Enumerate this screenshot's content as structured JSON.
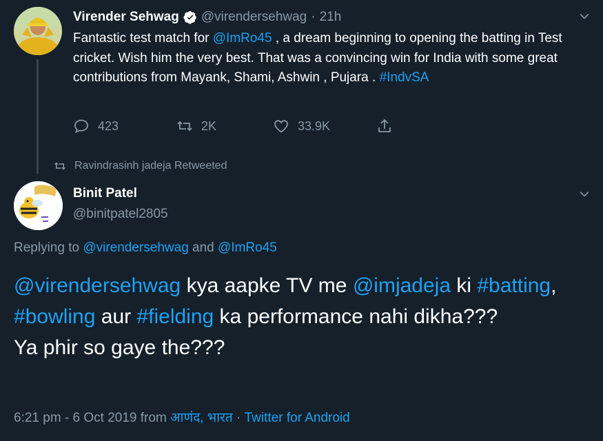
{
  "tweet1": {
    "name": "Virender Sehwag",
    "handle": "@virendersehwag",
    "separator": "·",
    "time": "21h",
    "text_parts": [
      {
        "t": "Fantastic test match for ",
        "link": false
      },
      {
        "t": "@ImRo45",
        "link": true
      },
      {
        "t": " , a dream beginning to opening the batting in Test cricket. Wish him the very best. That was a convincing win for India with some great contributions from Mayank, Shami, Ashwin , Pujara . ",
        "link": false
      },
      {
        "t": "#IndvSA",
        "link": true
      }
    ],
    "actions": {
      "replies": "423",
      "retweets": "2K",
      "likes": "33.9K"
    },
    "icons": [
      "verified-badge-icon",
      "chevron-down-icon",
      "reply-icon",
      "retweet-icon",
      "like-icon",
      "share-icon"
    ]
  },
  "retweet_context": {
    "label": "Ravindrasinh jadeja Retweeted"
  },
  "tweet2": {
    "name": "Binit Patel",
    "handle": "@binitpatel2805",
    "replying_prefix": "Replying to ",
    "replying_user1": "@virendersehwag",
    "replying_and": " and ",
    "replying_user2": "@ImRo45",
    "text_parts": [
      {
        "t": "@virendersehwag",
        "link": true
      },
      {
        "t": " kya aapke TV me ",
        "link": false
      },
      {
        "t": "@imjadeja",
        "link": true
      },
      {
        "t": " ki ",
        "link": false
      },
      {
        "t": "#batting",
        "link": true
      },
      {
        "t": ", ",
        "link": false
      },
      {
        "t": "#bowling",
        "link": true
      },
      {
        "t": " aur ",
        "link": false
      },
      {
        "t": "#fielding",
        "link": true
      },
      {
        "t": " ka performance nahi dikha???",
        "link": false
      },
      {
        "t": "\n",
        "link": false
      },
      {
        "t": "Ya phir so gaye the???",
        "link": false
      }
    ],
    "meta_time": "6:21 pm - 6 Oct 2019 from ",
    "meta_location": "आणंद, भारत",
    "meta_sep": " · ",
    "meta_source": "Twitter for Android"
  },
  "colors": {
    "background": "#15202b",
    "accent": "#1da1f2",
    "muted": "#8899a6",
    "text": "#ffffff"
  }
}
